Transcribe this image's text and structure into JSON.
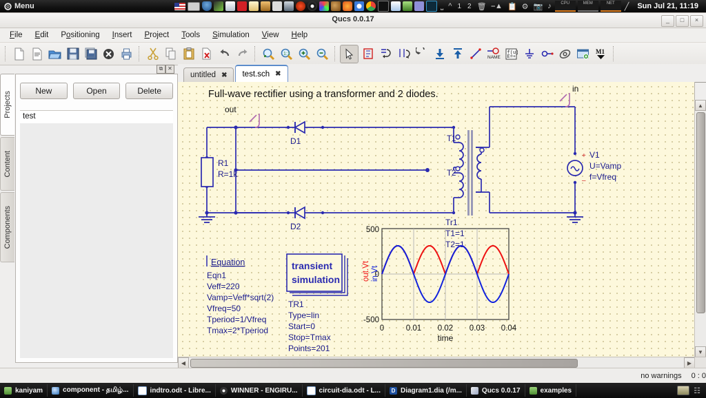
{
  "system_panel": {
    "menu_label": "Menu",
    "menu_icon": "gear-icon",
    "tray_numbers": [
      "1",
      "2"
    ],
    "cpu_label": "CPU",
    "mem_label": "MEM",
    "net_label": "NET",
    "clock": "Sun Jul 21, 11:19"
  },
  "window": {
    "title": "Qucs 0.0.17",
    "minimize": "_",
    "maximize": "□",
    "close": "×"
  },
  "menubar": {
    "items": [
      {
        "label": "File",
        "accel": "F"
      },
      {
        "label": "Edit",
        "accel": "E"
      },
      {
        "label": "Positioning",
        "accel": "o"
      },
      {
        "label": "Insert",
        "accel": "I"
      },
      {
        "label": "Project",
        "accel": "P"
      },
      {
        "label": "Tools",
        "accel": "T"
      },
      {
        "label": "Simulation",
        "accel": "S"
      },
      {
        "label": "View",
        "accel": "V"
      },
      {
        "label": "Help",
        "accel": "H"
      }
    ]
  },
  "toolbar": {
    "groups": [
      [
        "new-document-icon",
        "open-text-document-icon",
        "open-folder-icon",
        "save-icon",
        "save-all-icon",
        "close-document-icon",
        "print-icon"
      ],
      [
        "cut-icon",
        "copy-icon",
        "paste-icon",
        "delete-icon",
        "undo-icon",
        "redo-icon"
      ],
      [
        "zoom-fit-icon",
        "zoom-original-icon",
        "zoom-in-icon",
        "zoom-out-icon"
      ],
      [
        "select-arrow-icon",
        "edit-properties-icon",
        "rotate-icon",
        "mirror-x-icon",
        "mirror-y-icon",
        "move-down-icon",
        "move-up-icon",
        "wire-icon",
        "wire-label-icon",
        "equation-icon",
        "ground-icon",
        "port-icon",
        "simulate-icon",
        "show-page-icon",
        "marker-icon"
      ]
    ]
  },
  "dock": {
    "float_button": "⧉",
    "close_button": "✕",
    "vertical_tabs": [
      {
        "label": "Projects",
        "active": true
      },
      {
        "label": "Content",
        "active": false
      },
      {
        "label": "Components",
        "active": false
      }
    ],
    "buttons": [
      {
        "label": "New"
      },
      {
        "label": "Open"
      },
      {
        "label": "Delete"
      }
    ],
    "project_list": [
      "test"
    ]
  },
  "document_tabs": [
    {
      "label": "untitled",
      "close": "✖",
      "active": false
    },
    {
      "label": "test.sch",
      "close": "✖",
      "active": true
    }
  ],
  "schematic": {
    "title": "Full-wave rectifier using a transformer and 2 diodes.",
    "node_labels": [
      {
        "name": "out"
      },
      {
        "name": "in"
      }
    ],
    "components": [
      {
        "ref": "R1",
        "params": [
          "R=1k"
        ]
      },
      {
        "ref": "D1",
        "params": []
      },
      {
        "ref": "D2",
        "params": []
      },
      {
        "ref": "Tr1",
        "params": [
          "T1=1",
          "T2=1"
        ]
      },
      {
        "ref": "V1",
        "params": [
          "U=Vamp",
          "f=Vfreq"
        ]
      }
    ],
    "transformer_taps": [
      "T1",
      "T2"
    ],
    "equation_block": {
      "header": "Equation",
      "name": "Eqn1",
      "lines": [
        "Veff=220",
        "Vamp=Veff*sqrt(2)",
        "Vfreq=50",
        "Tperiod=1/Vfreq",
        "Tmax=2*Tperiod"
      ]
    },
    "simulation_block": {
      "title_line1": "transient",
      "title_line2": "simulation",
      "name": "TR1",
      "lines": [
        "Type=lin",
        "Start=0",
        "Stop=Tmax",
        "Points=201"
      ]
    }
  },
  "chart_data": {
    "type": "line",
    "title": "",
    "xlabel": "time",
    "ylabel": "",
    "xlim": [
      0,
      0.04
    ],
    "ylim": [
      -500,
      500
    ],
    "xticks": [
      "0",
      "0.01",
      "0.02",
      "0.03",
      "0.04"
    ],
    "yticks": [
      "500",
      "0",
      "-500"
    ],
    "grid": true,
    "legend_position": "left-vertical",
    "series": [
      {
        "name": "out.Vt",
        "color": "#ee1111",
        "description": "full-wave rectified sine, amplitude 311 V, period 0.02 s",
        "amplitude": 311,
        "period": 0.02,
        "x": [
          0,
          0.0025,
          0.005,
          0.0075,
          0.01,
          0.0125,
          0.015,
          0.0175,
          0.02,
          0.0225,
          0.025,
          0.0275,
          0.03,
          0.0325,
          0.035,
          0.0375,
          0.04
        ],
        "y": [
          0,
          220,
          311,
          220,
          0,
          220,
          311,
          220,
          0,
          220,
          311,
          220,
          0,
          220,
          311,
          220,
          0
        ]
      },
      {
        "name": "in.Vt",
        "color": "#1122dd",
        "description": "sine input, amplitude 311 V, period 0.02 s (negative half-cycles visible)",
        "amplitude": 311,
        "period": 0.02,
        "x": [
          0,
          0.0025,
          0.005,
          0.0075,
          0.01,
          0.0125,
          0.015,
          0.0175,
          0.02,
          0.0225,
          0.025,
          0.0275,
          0.03,
          0.0325,
          0.035,
          0.0375,
          0.04
        ],
        "y": [
          0,
          220,
          311,
          220,
          0,
          -220,
          -311,
          -220,
          0,
          220,
          311,
          220,
          0,
          -220,
          -311,
          -220,
          0
        ]
      }
    ]
  },
  "statusbar": {
    "warnings": "no warnings",
    "coords": "0 : 0"
  },
  "taskbar": {
    "items": [
      {
        "label": "kaniyam",
        "icon": "folder-icon"
      },
      {
        "label": "component - தமிழ்...",
        "icon": "image-editor-icon"
      },
      {
        "label": "indtro.odt - Libre...",
        "icon": "document-icon"
      },
      {
        "label": "WINNER - ENGIRU...",
        "icon": "media-icon"
      },
      {
        "label": "circuit-dia.odt - L...",
        "icon": "document-icon"
      },
      {
        "label": "Diagram1.dia (/m...",
        "icon": "dia-icon"
      },
      {
        "label": "Qucs 0.0.17",
        "icon": "qucs-icon"
      },
      {
        "label": "examples",
        "icon": "folder-icon"
      }
    ]
  },
  "colors": {
    "canvas_bg": "#fdf8dc",
    "wire": "#2a2ab0",
    "label": "#b06ab0",
    "text": "#1a1a8c",
    "red_trace": "#ee1111",
    "blue_trace": "#1122dd"
  }
}
